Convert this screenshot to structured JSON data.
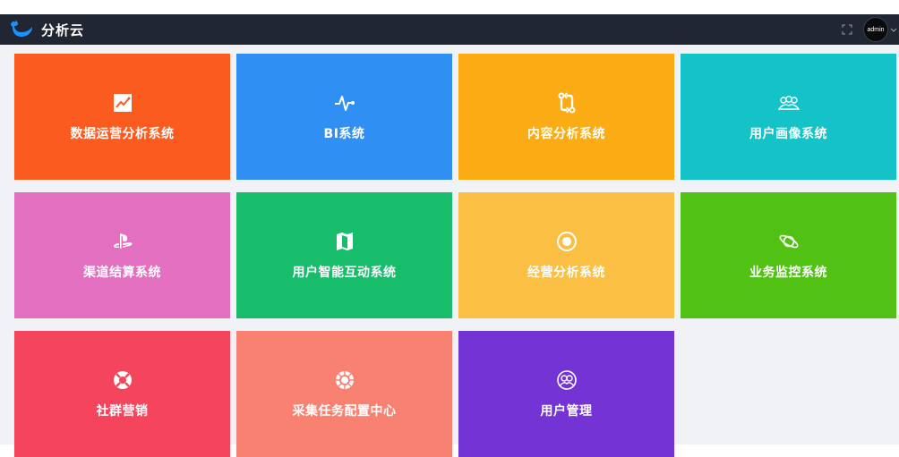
{
  "header": {
    "app_title": "分析云",
    "user": "admin",
    "background_color": "#202733"
  },
  "tiles": [
    {
      "label": "数据运营分析系统",
      "color": "#fb5b1f",
      "icon": "line-chart-icon"
    },
    {
      "label": "BI系统",
      "color": "#2f8ff2",
      "icon": "pulse-icon"
    },
    {
      "label": "内容分析系统",
      "color": "#fbac14",
      "icon": "git-compare-icon"
    },
    {
      "label": "用户画像系统",
      "color": "#14c3c8",
      "icon": "users-icon"
    },
    {
      "label": "渠道结算系统",
      "color": "#e36fc0",
      "icon": "playstation-icon"
    },
    {
      "label": "用户智能互动系统",
      "color": "#17bd6b",
      "icon": "map-icon"
    },
    {
      "label": "经营分析系统",
      "color": "#fbbf43",
      "icon": "target-icon"
    },
    {
      "label": "业务监控系统",
      "color": "#51c214",
      "icon": "planet-icon"
    },
    {
      "label": "社群营销",
      "color": "#f4455d",
      "icon": "lifebuoy-icon"
    },
    {
      "label": "采集任务配置中心",
      "color": "#f88171",
      "icon": "settings-wheel-icon"
    },
    {
      "label": "用户管理",
      "color": "#7433d4",
      "icon": "user-group-icon"
    }
  ]
}
